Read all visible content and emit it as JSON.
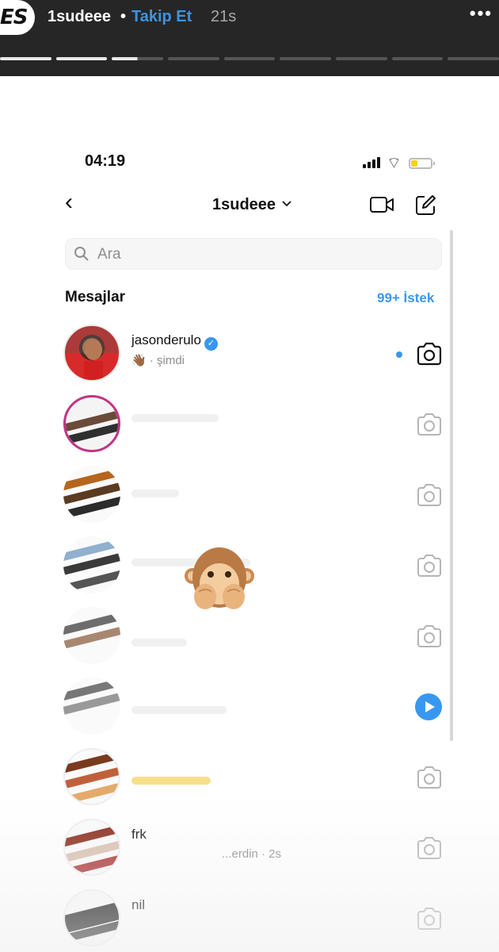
{
  "story": {
    "avatar_initials": "ES",
    "username": "1sudeee",
    "separator": "•",
    "follow_label": "Takip Et",
    "time": "21s",
    "more": "•••",
    "segments": 9,
    "segments_done": 2,
    "current_segment_progress": 0.5
  },
  "status_bar": {
    "time": "04:19",
    "battery_level": 0.35
  },
  "header": {
    "back_icon": "chevron-left-icon",
    "title": "1sudeee",
    "title_chevron": "⌄",
    "video_icon": "video-camera-icon",
    "compose_icon": "new-message-icon"
  },
  "search": {
    "placeholder": "Ara"
  },
  "messages": {
    "title": "Mesajlar",
    "requests_label": "99+ İstek"
  },
  "threads": [
    {
      "name": "jasonderulo",
      "verified": true,
      "preview": "👋🏾 · şimdi",
      "unread": true,
      "action": "camera-icon"
    },
    {
      "name": "",
      "preview": "",
      "unread": false,
      "action": "camera-icon"
    },
    {
      "name": "",
      "preview": "",
      "unread": false,
      "action": "camera-icon"
    },
    {
      "name": "",
      "preview": "",
      "unread": false,
      "action": "camera-icon"
    },
    {
      "name": "",
      "preview": "",
      "unread": false,
      "action": "camera-icon"
    },
    {
      "name": "",
      "preview": "",
      "unread": false,
      "action": "play-icon"
    },
    {
      "name": "",
      "preview": "",
      "unread": false,
      "action": "camera-icon"
    },
    {
      "name": "frk",
      "preview": "...erdin · 2s",
      "unread": false,
      "action": "camera-icon"
    },
    {
      "name": "nil",
      "preview": "",
      "unread": false,
      "action": "camera-icon"
    }
  ],
  "overlay_sticker": "see-no-evil-monkey-icon",
  "colors": {
    "accent": "#3897f0",
    "story_bar": "#262626",
    "follow": "#3f93e0"
  }
}
